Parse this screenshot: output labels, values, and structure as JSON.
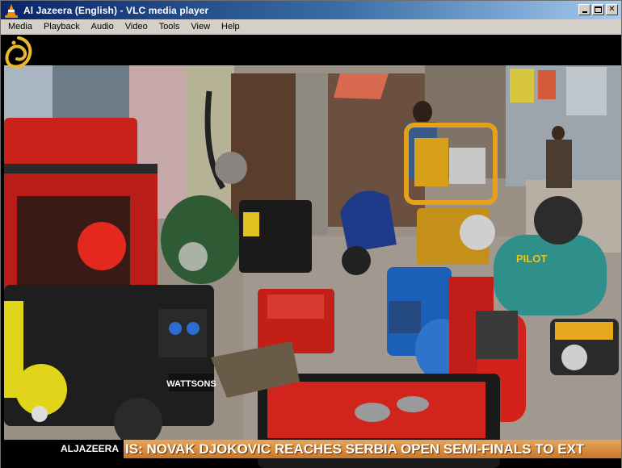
{
  "window": {
    "title": "Al Jazeera (English) - VLC media player",
    "controls": {
      "minimize": "",
      "maximize": "",
      "close": "✕"
    }
  },
  "menu": {
    "items": [
      "Media",
      "Playback",
      "Audio",
      "Video",
      "Tools",
      "View",
      "Help"
    ]
  },
  "video": {
    "ticker": {
      "channel": "ALJAZEERA",
      "headline": "IS: NOVAK DJOKOVIC REACHES SERBIA OPEN SEMI-FINALS TO EXT"
    },
    "signs": {
      "pilot": "PILOT",
      "watsons": "WATTSONS"
    }
  },
  "colors": {
    "titlebar_start": "#0a246a",
    "titlebar_end": "#a6caf0",
    "ticker": "#d08a3a",
    "generator_red": "#d3221c",
    "compressor_teal": "#2f8f8a"
  }
}
